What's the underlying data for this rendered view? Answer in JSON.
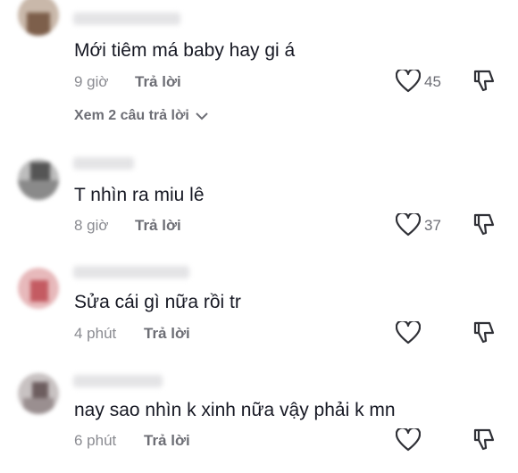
{
  "comments": [
    {
      "text": "Mới tiêm má baby hay gi á",
      "time": "9 giờ",
      "reply_label": "Trả lời",
      "likes": "45"
    },
    {
      "text": "T nhìn ra miu lê",
      "time": "8 giờ",
      "reply_label": "Trả lời",
      "likes": "37"
    },
    {
      "text": "Sửa cái gì nữa rồi tr",
      "time": "4 phút",
      "reply_label": "Trả lời",
      "likes": ""
    },
    {
      "text": "nay sao nhìn k xinh nữa vậy phải k mn",
      "time": "6 phút",
      "reply_label": "Trả lời",
      "likes": ""
    }
  ],
  "view_replies_label": "Xem 2 câu trả lời",
  "colors": {
    "text": "#161823",
    "secondary": "#8a8b91",
    "icon": "#2f3036"
  },
  "icons": {
    "like": "heart-outline-icon",
    "dislike": "thumbs-down-outline-icon",
    "expand": "chevron-down-icon"
  }
}
